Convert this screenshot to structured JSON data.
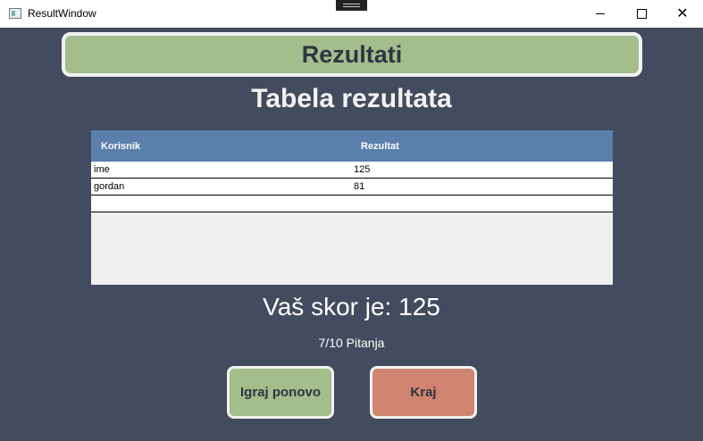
{
  "window": {
    "title": "ResultWindow",
    "app_icon": "window-app-icon",
    "controls": {
      "minimize": "minimize-icon",
      "maximize": "maximize-icon",
      "close": "close-icon"
    }
  },
  "header": {
    "title": "Rezultati"
  },
  "subtitle": "Tabela rezultata",
  "table": {
    "columns": [
      "Korisnik",
      "Rezultat"
    ],
    "rows": [
      {
        "user": "ime",
        "score": "125"
      },
      {
        "user": "gordan",
        "score": "81"
      },
      {
        "user": "",
        "score": ""
      }
    ]
  },
  "score_text": "Vaš skor je: 125",
  "questions_text": "7/10 Pitanja",
  "buttons": {
    "play_again": "Igraj ponovo",
    "end": "Kraj"
  },
  "colors": {
    "background": "#434b5e",
    "header_green": "#a3bd8b",
    "table_header_blue": "#5b7fab",
    "end_button": "#d08570"
  }
}
